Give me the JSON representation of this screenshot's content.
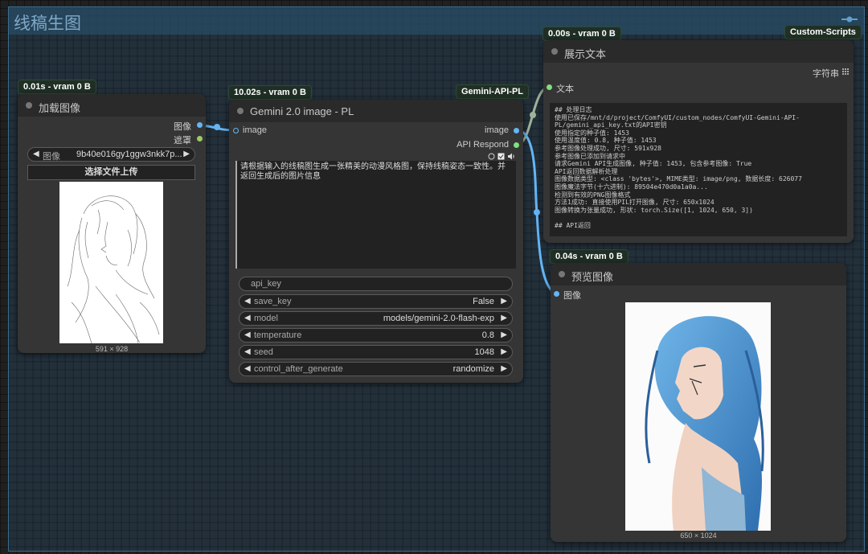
{
  "group": {
    "title": "线稿生图"
  },
  "badges": {
    "load_image": "0.01s - vram 0 B",
    "gemini": "10.02s - vram 0 B",
    "gemini_tag": "Gemini-API-PL",
    "show_text": "0.00s - vram 0 B",
    "show_text_tag": "Custom-Scripts",
    "preview": "0.04s - vram 0 B"
  },
  "load_image": {
    "title": "加载图像",
    "outputs": [
      "图像",
      "遮罩"
    ],
    "image_label": "图像",
    "image_value": "9b40e016gy1ggw3nkk7p...",
    "upload_label": "选择文件上传",
    "size_caption": "591 × 928"
  },
  "gemini": {
    "title": "Gemini 2.0 image - PL",
    "input": "image",
    "outputs": [
      "image",
      "API Respond"
    ],
    "prompt": "请根据输入的线稿图生成一张精美的动漫风格图，保持线稿姿态一致性。并返回生成后的图片信息",
    "widgets": [
      {
        "label": "api_key",
        "value": ""
      },
      {
        "label": "save_key",
        "value": "False"
      },
      {
        "label": "model",
        "value": "models/gemini-2.0-flash-exp"
      },
      {
        "label": "temperature",
        "value": "0.8"
      },
      {
        "label": "seed",
        "value": "1048"
      },
      {
        "label": "control_after_generate",
        "value": "randomize"
      }
    ]
  },
  "show_text": {
    "title": "展示文本",
    "input": "文本",
    "output": "字符串",
    "log": "## 处理日志\n使用已保存/mnt/d/project/ComfyUI/custom_nodes/ComfyUI-Gemini-API-\nPL/gemini_api_key.txt的API密钥\n使用指定的种子值: 1453\n使用温度值: 0.8, 种子值: 1453\n参考图像处理成功, 尺寸: 591x928\n参考图像已添加到请求中\n请求Gemini API生成图像, 种子值: 1453, 包含参考图像: True\nAPI返回数据解析处理\n图像数据类型: <class 'bytes'>, MIME类型: image/png, 数据长度: 626077\n图像魔法字节(十六进制): 89504e470d0a1a0a...\n检测到有效的PNG图像格式\n方法1成功: 直接使用PIL打开图像, 尺寸: 650x1024\n图像转换为张量成功, 形状: torch.Size([1, 1024, 650, 3])\n\n## API返回"
  },
  "preview": {
    "title": "预览图像",
    "input": "图像",
    "size_caption": "650 × 1024"
  }
}
